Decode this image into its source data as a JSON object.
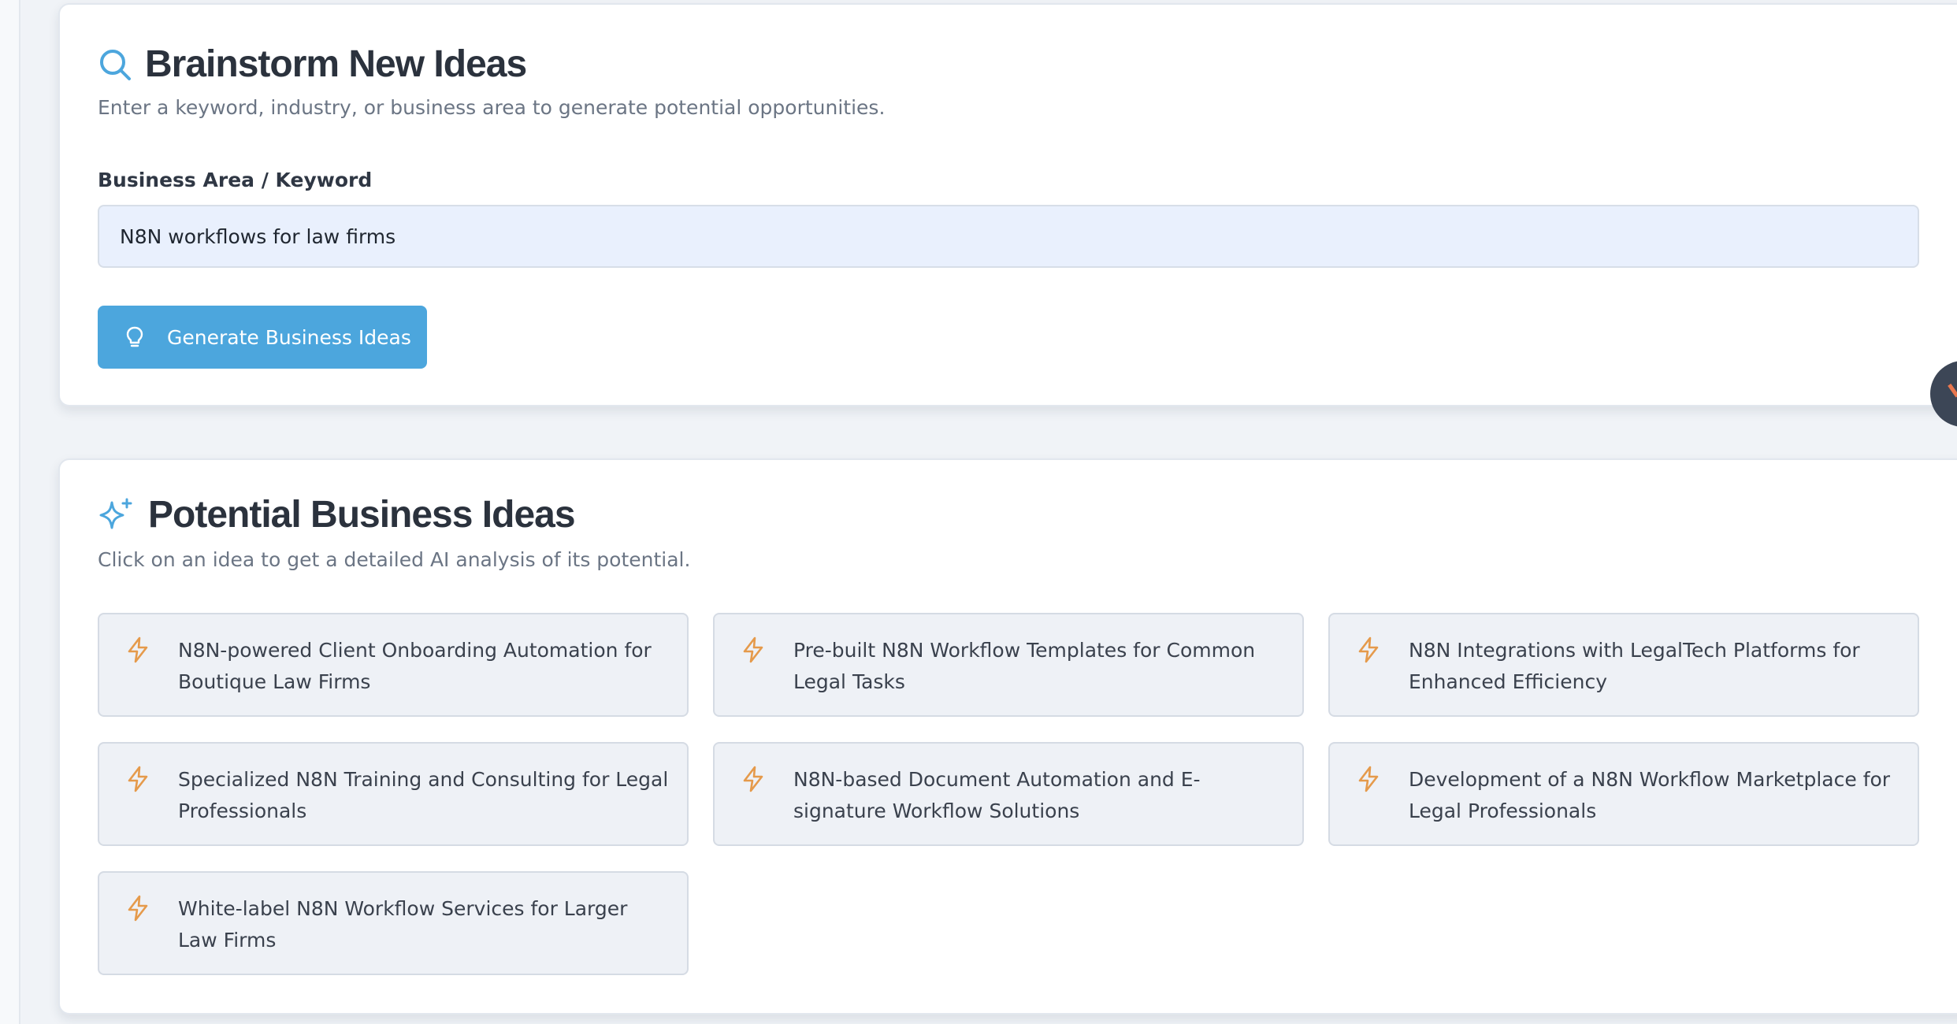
{
  "brainstorm": {
    "title": "Brainstorm New Ideas",
    "subtitle": "Enter a keyword, industry, or business area to generate potential opportunities.",
    "field_label": "Business Area / Keyword",
    "field_value": "N8N workflows for law firms",
    "button_label": "Generate Business Ideas",
    "title_icon": "search-icon",
    "button_icon": "lightbulb-icon"
  },
  "ideas": {
    "title": "Potential Business Ideas",
    "subtitle": "Click on an idea to get a detailed AI analysis of its potential.",
    "title_icon": "sparkles-icon",
    "item_icon": "lightning-icon",
    "items": [
      {
        "label": "N8N-powered Client Onboarding Automation for Boutique Law Firms"
      },
      {
        "label": "Pre-built N8N Workflow Templates for Common Legal Tasks"
      },
      {
        "label": "N8N Integrations with LegalTech Platforms for Enhanced Efficiency"
      },
      {
        "label": "Specialized N8N Training and Consulting for Legal Professionals"
      },
      {
        "label": "N8N-based Document Automation and E-signature Workflow Solutions"
      },
      {
        "label": "Development of a N8N Workflow Marketplace for Legal Professionals"
      },
      {
        "label": "White-label N8N Workflow Services for Larger Law Firms"
      }
    ]
  },
  "colors": {
    "accent": "#4ca6dd",
    "icon_orange": "#e59a4b",
    "page_bg": "#f0f3f7",
    "input_bg": "#e9f0fd"
  },
  "floating_button": {
    "icon": "chat-bubble-icon"
  }
}
